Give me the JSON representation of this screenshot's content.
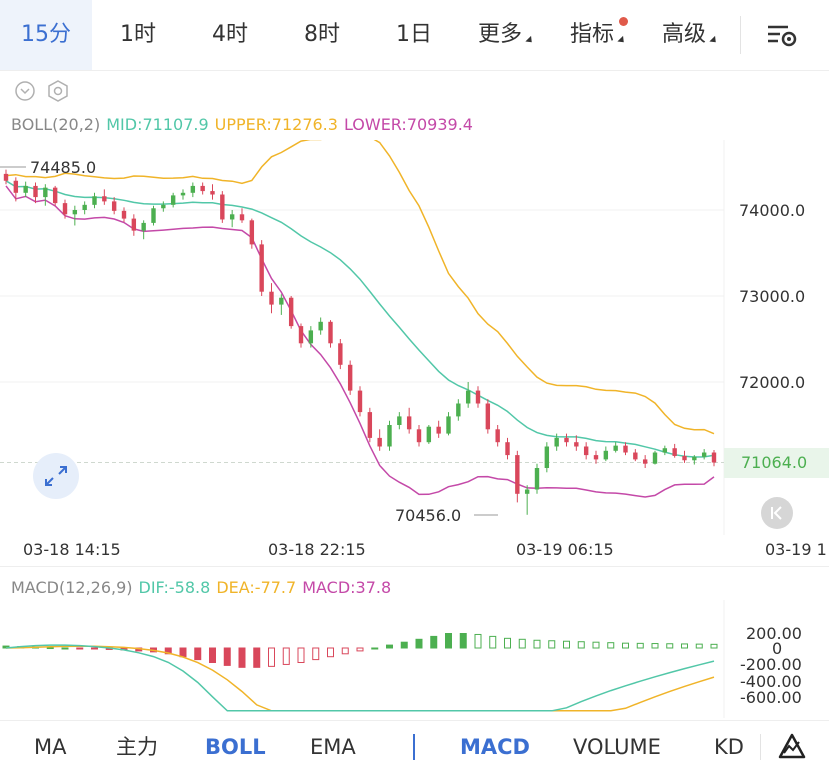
{
  "tabs": [
    {
      "label": "15分",
      "active": true
    },
    {
      "label": "1时"
    },
    {
      "label": "4时"
    },
    {
      "label": "8时"
    },
    {
      "label": "1日"
    },
    {
      "label": "更多"
    },
    {
      "label": "指标"
    },
    {
      "label": "高级"
    }
  ],
  "boll_legend": {
    "name": "BOLL(20,2)",
    "mid": "MID:71107.9",
    "upper": "UPPER:71276.3",
    "lower": "LOWER:70939.4"
  },
  "macd_legend": {
    "name": "MACD(12,26,9)",
    "dif": "DIF:-58.8",
    "dea": "DEA:-77.7",
    "macd": "MACD:37.8"
  },
  "price_axis": [
    "74000.0",
    "73000.0",
    "72000.0"
  ],
  "current_price": "71064.0",
  "high_marker": "74485.0",
  "low_marker": "70456.0",
  "time_labels": [
    "03-18 14:15",
    "03-18 22:15",
    "03-19 06:15",
    "03-19 1"
  ],
  "macd_axis": [
    "200.00",
    "0",
    "-200.00",
    "-400.00",
    "-600.00"
  ],
  "bottom_tabs": [
    {
      "label": "MA"
    },
    {
      "label": "主力"
    },
    {
      "label": "BOLL",
      "selected": true
    },
    {
      "label": "EMA"
    },
    {
      "label": "MACD",
      "selected": true
    },
    {
      "label": "VOLUME"
    },
    {
      "label": "KD"
    }
  ],
  "colors": {
    "up": "#4caf50",
    "down": "#d9475b",
    "mid": "#52c7a8",
    "upper": "#f0b429",
    "lower": "#c449a8",
    "accent": "#3b6fd1"
  },
  "chart_data": {
    "type": "candlestick",
    "price_range": [
      70200,
      74900
    ],
    "macd_range": [
      -650,
      250
    ],
    "candles": [
      [
        74420,
        74470,
        74300,
        74340
      ],
      [
        74340,
        74380,
        74100,
        74200
      ],
      [
        74200,
        74330,
        74150,
        74280
      ],
      [
        74280,
        74320,
        74080,
        74150
      ],
      [
        74150,
        74300,
        74050,
        74260
      ],
      [
        74260,
        74280,
        74050,
        74080
      ],
      [
        74080,
        74120,
        73900,
        73950
      ],
      [
        73950,
        74050,
        73820,
        74000
      ],
      [
        74000,
        74100,
        73950,
        74060
      ],
      [
        74060,
        74200,
        74020,
        74160
      ],
      [
        74160,
        74240,
        74060,
        74100
      ],
      [
        74100,
        74150,
        73950,
        73990
      ],
      [
        73990,
        74030,
        73860,
        73900
      ],
      [
        73900,
        73950,
        73700,
        73760
      ],
      [
        73760,
        73880,
        73660,
        73850
      ],
      [
        73850,
        74050,
        73820,
        74020
      ],
      [
        74020,
        74100,
        73980,
        74060
      ],
      [
        74060,
        74200,
        74030,
        74170
      ],
      [
        74170,
        74240,
        74120,
        74200
      ],
      [
        74200,
        74320,
        74150,
        74280
      ],
      [
        74280,
        74320,
        74180,
        74220
      ],
      [
        74220,
        74300,
        74120,
        74180
      ],
      [
        74180,
        74220,
        73850,
        73890
      ],
      [
        73890,
        74000,
        73800,
        73950
      ],
      [
        73950,
        74020,
        73850,
        73880
      ],
      [
        73880,
        73900,
        73550,
        73600
      ],
      [
        73600,
        73650,
        73000,
        73050
      ],
      [
        73050,
        73150,
        72800,
        72900
      ],
      [
        72900,
        73020,
        72780,
        72980
      ],
      [
        72980,
        73000,
        72620,
        72650
      ],
      [
        72650,
        72680,
        72400,
        72450
      ],
      [
        72450,
        72650,
        72400,
        72600
      ],
      [
        72600,
        72750,
        72550,
        72700
      ],
      [
        72700,
        72720,
        72400,
        72450
      ],
      [
        72450,
        72500,
        72150,
        72200
      ],
      [
        72200,
        72250,
        71850,
        71900
      ],
      [
        71900,
        71950,
        71600,
        71650
      ],
      [
        71650,
        71700,
        71300,
        71350
      ],
      [
        71350,
        71450,
        71200,
        71250
      ],
      [
        71250,
        71550,
        71200,
        71500
      ],
      [
        71500,
        71650,
        71450,
        71600
      ],
      [
        71600,
        71700,
        71400,
        71450
      ],
      [
        71450,
        71500,
        71250,
        71300
      ],
      [
        71300,
        71500,
        71280,
        71480
      ],
      [
        71480,
        71550,
        71350,
        71400
      ],
      [
        71400,
        71650,
        71380,
        71600
      ],
      [
        71600,
        71800,
        71550,
        71750
      ],
      [
        71750,
        72000,
        71700,
        71900
      ],
      [
        71900,
        71950,
        71700,
        71750
      ],
      [
        71750,
        71800,
        71400,
        71450
      ],
      [
        71450,
        71500,
        71250,
        71300
      ],
      [
        71300,
        71350,
        71100,
        71150
      ],
      [
        71150,
        71200,
        70600,
        70700
      ],
      [
        70700,
        70800,
        70456,
        70750
      ],
      [
        70750,
        71050,
        70700,
        71000
      ],
      [
        71000,
        71300,
        70950,
        71250
      ],
      [
        71250,
        71400,
        71200,
        71350
      ],
      [
        71350,
        71400,
        71250,
        71300
      ],
      [
        71300,
        71380,
        71200,
        71250
      ],
      [
        71250,
        71300,
        71100,
        71150
      ],
      [
        71150,
        71200,
        71050,
        71100
      ],
      [
        71100,
        71250,
        71080,
        71200
      ],
      [
        71200,
        71300,
        71180,
        71260
      ],
      [
        71260,
        71300,
        71150,
        71180
      ],
      [
        71180,
        71220,
        71080,
        71100
      ],
      [
        71100,
        71150,
        71000,
        71050
      ],
      [
        71050,
        71200,
        71040,
        71180
      ],
      [
        71180,
        71260,
        71150,
        71230
      ],
      [
        71230,
        71280,
        71120,
        71140
      ],
      [
        71140,
        71200,
        71060,
        71090
      ],
      [
        71090,
        71150,
        71040,
        71130
      ],
      [
        71130,
        71220,
        71100,
        71180
      ],
      [
        71180,
        71210,
        71020,
        71064
      ]
    ],
    "macd_hist": [
      20,
      15,
      10,
      5,
      0,
      -5,
      -10,
      -15,
      -20,
      -30,
      -40,
      -60,
      -90,
      -120,
      -150,
      -180,
      -200,
      -200,
      -190,
      -170,
      -150,
      -120,
      -90,
      -60,
      -30,
      0,
      30,
      60,
      90,
      120,
      150,
      150,
      140,
      120,
      100,
      90,
      80,
      75,
      70,
      65,
      60,
      55,
      50,
      48,
      46,
      44,
      42,
      40,
      38
    ]
  }
}
